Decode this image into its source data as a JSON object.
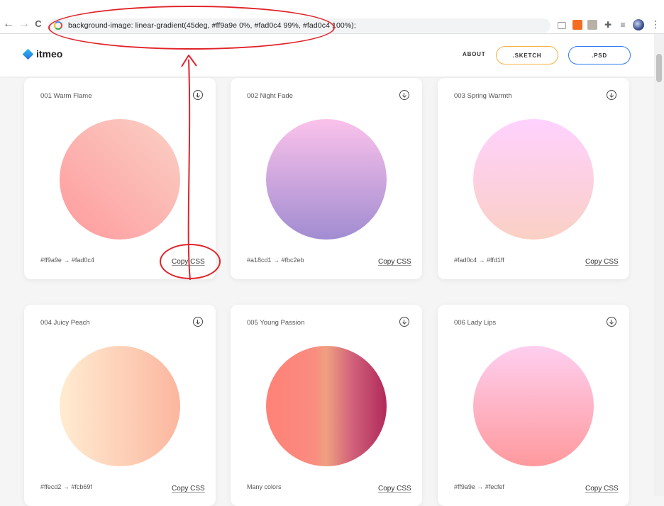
{
  "browser": {
    "url_text": "background-image: linear-gradient(45deg, #ff9a9e 0%, #fad0c4 99%, #fad0c4 100%);",
    "back_glyph": "←",
    "forward_glyph": "→",
    "reload_glyph": "C",
    "menu_glyph": "⋮",
    "icons": [
      "back-icon",
      "forward-icon",
      "reload-icon",
      "google-icon",
      "extension-icon",
      "puzzle-icon",
      "playlist-icon",
      "profile-avatar-icon"
    ]
  },
  "site": {
    "logo": "itmeo",
    "nav": {
      "about": "ABOUT",
      "sketch": ".SKETCH",
      "psd": ".PSD"
    }
  },
  "arrow": "→",
  "cards": [
    {
      "title": "001 Warm Flame",
      "from": "#ff9a9e",
      "to": "#fad0c4",
      "hexes": "#ff9a9e  →  #fad0c4",
      "copy": "Copy CSS"
    },
    {
      "title": "002 Night Fade",
      "from": "#a18cd1",
      "to": "#fbc2eb",
      "hexes": "#a18cd1  →  #fbc2eb",
      "copy": "Copy CSS"
    },
    {
      "title": "003 Spring Warmth",
      "from": "#fad0c4",
      "to": "#ffd1ff",
      "hexes": "#fad0c4  →  #ffd1ff",
      "copy": "Copy CSS"
    },
    {
      "title": "004 Juicy Peach",
      "from": "#ffecd2",
      "to": "#fcb69f",
      "hexes": "#ffecd2  →  #fcb69f",
      "copy": "Copy CSS"
    },
    {
      "title": "005 Young Passion",
      "from": "#ff8177",
      "to": "#b12a5b",
      "hexes": "Many colors",
      "copy": "Copy CSS"
    },
    {
      "title": "006 Lady Lips",
      "from": "#ff9a9e",
      "to": "#fecfef",
      "hexes": "#ff9a9e  →  #fecfef",
      "copy": "Copy CSS"
    }
  ],
  "colors": {
    "annotation": "#e0242a",
    "sketch_border": "#f5b342",
    "psd_border": "#2f7bf6"
  }
}
